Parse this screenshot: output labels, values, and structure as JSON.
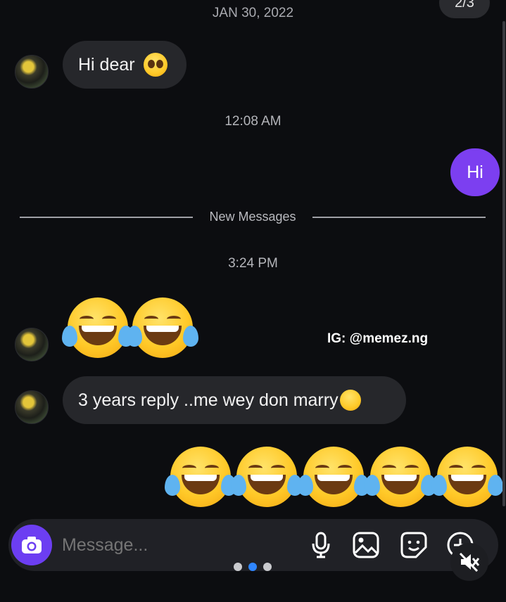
{
  "page_indicator": "2/3",
  "date_header": "JAN 30, 2022",
  "messages": [
    {
      "direction": "incoming",
      "text": "Hi dear",
      "emoji": "pleading-face"
    },
    {
      "type": "timestamp",
      "text": "12:08 AM"
    },
    {
      "direction": "outgoing",
      "text": "Hi"
    },
    {
      "type": "divider",
      "text": "New Messages"
    },
    {
      "type": "timestamp",
      "text": "3:24 PM"
    },
    {
      "direction": "incoming",
      "emoji_only": [
        "face-with-tears-of-joy",
        "face-with-tears-of-joy"
      ]
    },
    {
      "direction": "incoming",
      "text": "3 years reply ..me wey don marry",
      "emoji": "face-with-tears-of-joy"
    },
    {
      "direction": "outgoing",
      "emoji_only": [
        "face-with-tears-of-joy",
        "face-with-tears-of-joy",
        "face-with-tears-of-joy",
        "face-with-tears-of-joy",
        "face-with-tears-of-joy"
      ]
    }
  ],
  "watermark": "IG: @memez.ng",
  "composer": {
    "placeholder": "Message...",
    "icons": [
      "camera-icon",
      "microphone-icon",
      "image-icon",
      "sticker-icon",
      "add-icon"
    ]
  },
  "carousel": {
    "count": 3,
    "active_index": 1
  },
  "mute_icon": "speaker-muted-icon",
  "colors": {
    "background": "#0c0d10",
    "incoming_bubble": "#26272b",
    "outgoing_bubble": "#7c3ff0",
    "camera_button": "#6c3ef2",
    "active_dot": "#2f86ff"
  }
}
